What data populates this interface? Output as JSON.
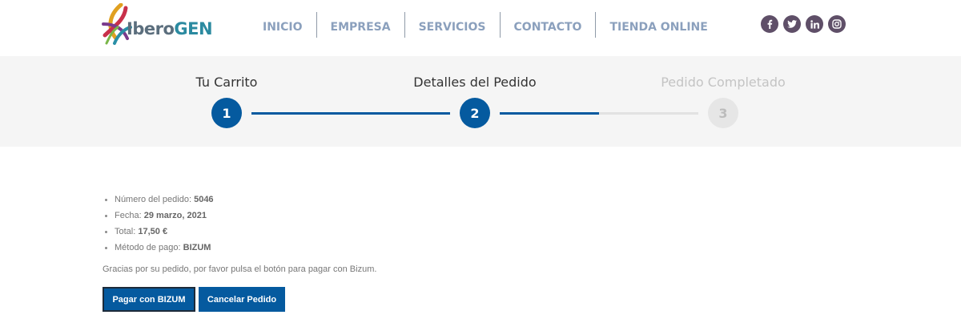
{
  "brand": {
    "logo_prefix": "Ibero",
    "logo_suffix": "GEN",
    "logo_icon": "helix-logo-icon"
  },
  "nav": {
    "items": [
      {
        "label": "INICIO"
      },
      {
        "label": "EMPRESA"
      },
      {
        "label": "SERVICIOS"
      },
      {
        "label": "CONTACTO"
      },
      {
        "label": "TIENDA ONLINE"
      }
    ]
  },
  "social": [
    "facebook-icon",
    "twitter-icon",
    "linkedin-icon",
    "instagram-icon"
  ],
  "steps": [
    {
      "label": "Tu Carrito",
      "number": "1",
      "state": "done"
    },
    {
      "label": "Detalles del Pedido",
      "number": "2",
      "state": "current"
    },
    {
      "label": "Pedido Completado",
      "number": "3",
      "state": "pending"
    }
  ],
  "order": {
    "number_label": "Número del pedido:",
    "number_value": "5046",
    "date_label": "Fecha:",
    "date_value": "29 marzo, 2021",
    "total_label": "Total:",
    "total_value": "17,50 €",
    "method_label": "Método de pago:",
    "method_value": "BIZUM"
  },
  "message": "Gracias por su pedido, por favor pulsa el botón para pagar con Bizum.",
  "actions": {
    "pay_label": "Pagar con BIZUM",
    "cancel_label": "Cancelar Pedido"
  },
  "colors": {
    "primary": "#055a9f",
    "nav_text": "#8ba0bd",
    "social_bg": "#5f4f68",
    "band_bg": "#f5f5f5"
  }
}
